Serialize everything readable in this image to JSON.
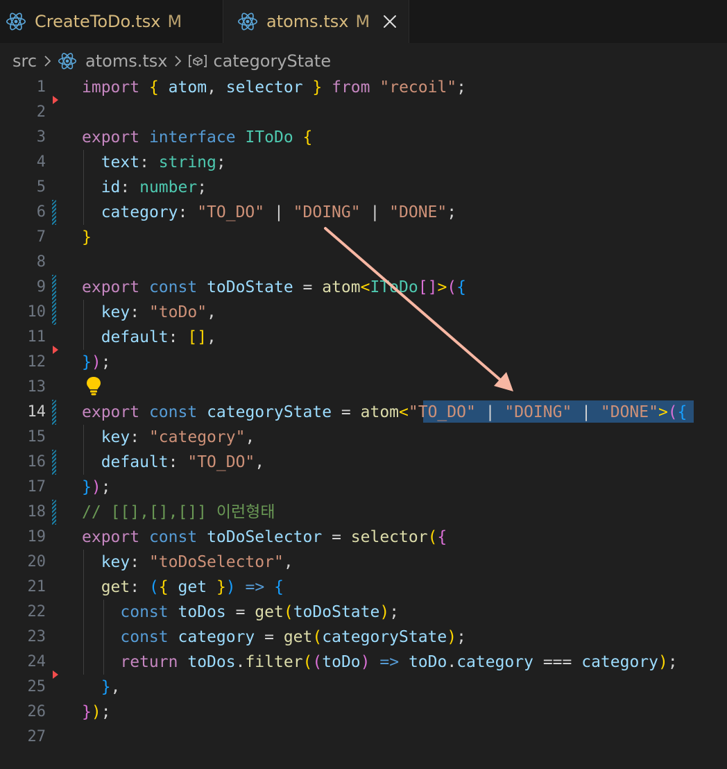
{
  "tabs": [
    {
      "filename": "CreateToDo.tsx",
      "status": "M"
    },
    {
      "filename": "atoms.tsx",
      "status": "M"
    }
  ],
  "breadcrumb": {
    "root": "src",
    "file": "atoms.tsx",
    "symbol": "categoryState"
  },
  "editor": {
    "current_line": 14,
    "lines": [
      {
        "n": "1",
        "tokens": [
          [
            "kw",
            "import"
          ],
          [
            "",
            "&nbsp;"
          ],
          [
            "p1",
            "{"
          ],
          [
            "",
            ""
          ],
          [
            "va",
            " atom"
          ],
          [
            "op",
            ","
          ],
          [
            "va",
            " selector "
          ],
          [
            "p1",
            "}"
          ],
          [
            "kw",
            " from "
          ],
          [
            "st",
            "\"recoil\""
          ],
          [
            "op",
            ";"
          ]
        ]
      }
    ]
  },
  "code": [
    {
      "n": "1"
    },
    {
      "n": "2"
    },
    {
      "n": "3"
    },
    {
      "n": "4"
    },
    {
      "n": "5"
    },
    {
      "n": "6"
    },
    {
      "n": "7"
    },
    {
      "n": "8"
    },
    {
      "n": "9"
    },
    {
      "n": "10"
    },
    {
      "n": "11"
    },
    {
      "n": "12"
    },
    {
      "n": "13"
    },
    {
      "n": "14"
    },
    {
      "n": "15"
    },
    {
      "n": "16"
    },
    {
      "n": "17"
    },
    {
      "n": "18"
    },
    {
      "n": "19"
    },
    {
      "n": "20"
    },
    {
      "n": "21"
    },
    {
      "n": "22"
    },
    {
      "n": "23"
    },
    {
      "n": "24"
    },
    {
      "n": "25"
    },
    {
      "n": "26"
    },
    {
      "n": "27"
    }
  ],
  "source": [
    [
      [
        "kw",
        "import"
      ],
      [
        "op",
        " "
      ],
      [
        "p1",
        "{"
      ],
      [
        "va",
        " atom"
      ],
      [
        "op",
        ", "
      ],
      [
        "va",
        "selector"
      ],
      [
        "op",
        " "
      ],
      [
        "p1",
        "}"
      ],
      [
        "kw",
        " from"
      ],
      [
        "op",
        " "
      ],
      [
        "st",
        "\"recoil\""
      ],
      [
        "op",
        ";"
      ]
    ],
    [],
    [
      [
        "kw",
        "export"
      ],
      [
        "op",
        " "
      ],
      [
        "bl",
        "interface"
      ],
      [
        "op",
        " "
      ],
      [
        "ty",
        "IToDo"
      ],
      [
        "op",
        " "
      ],
      [
        "p1",
        "{"
      ]
    ],
    [
      [
        "op",
        "  "
      ],
      [
        "va",
        "text"
      ],
      [
        "op",
        ": "
      ],
      [
        "ty",
        "string"
      ],
      [
        "op",
        ";"
      ]
    ],
    [
      [
        "op",
        "  "
      ],
      [
        "va",
        "id"
      ],
      [
        "op",
        ": "
      ],
      [
        "ty",
        "number"
      ],
      [
        "op",
        ";"
      ]
    ],
    [
      [
        "op",
        "  "
      ],
      [
        "va",
        "category"
      ],
      [
        "op",
        ": "
      ],
      [
        "st",
        "\"TO_DO\""
      ],
      [
        "op",
        " | "
      ],
      [
        "st",
        "\"DOING\""
      ],
      [
        "op",
        " | "
      ],
      [
        "st",
        "\"DONE\""
      ],
      [
        "op",
        ";"
      ]
    ],
    [
      [
        "p1",
        "}"
      ]
    ],
    [],
    [
      [
        "kw",
        "export"
      ],
      [
        "op",
        " "
      ],
      [
        "bl",
        "const"
      ],
      [
        "op",
        " "
      ],
      [
        "va",
        "toDoState"
      ],
      [
        "op",
        " = "
      ],
      [
        "fn",
        "atom"
      ],
      [
        "p1",
        "<"
      ],
      [
        "ty",
        "IToDo"
      ],
      [
        "p2",
        "[]"
      ],
      [
        "p1",
        ">"
      ],
      [
        "p2",
        "("
      ],
      [
        "p3",
        "{"
      ]
    ],
    [
      [
        "op",
        "  "
      ],
      [
        "va",
        "key"
      ],
      [
        "op",
        ": "
      ],
      [
        "st",
        "\"toDo\""
      ],
      [
        "op",
        ","
      ]
    ],
    [
      [
        "op",
        "  "
      ],
      [
        "va",
        "default"
      ],
      [
        "op",
        ": "
      ],
      [
        "p1",
        "[]"
      ],
      [
        "op",
        ","
      ]
    ],
    [
      [
        "p3",
        "}"
      ],
      [
        "p2",
        ")"
      ],
      [
        "op",
        ";"
      ]
    ],
    [],
    [
      [
        "kw",
        "export"
      ],
      [
        "op",
        " "
      ],
      [
        "bl",
        "const"
      ],
      [
        "op",
        " "
      ],
      [
        "va",
        "categoryState"
      ],
      [
        "op",
        " = "
      ],
      [
        "fn",
        "atom"
      ],
      [
        "p1",
        "<"
      ],
      [
        "st",
        "\"TO_DO\""
      ],
      [
        "op",
        " | "
      ],
      [
        "st",
        "\"DOING\""
      ],
      [
        "op",
        " | "
      ],
      [
        "st",
        "\"DONE\""
      ],
      [
        "p1",
        ">"
      ],
      [
        "p2",
        "("
      ],
      [
        "p3",
        "{"
      ]
    ],
    [
      [
        "op",
        "  "
      ],
      [
        "va",
        "key"
      ],
      [
        "op",
        ": "
      ],
      [
        "st",
        "\"category\""
      ],
      [
        "op",
        ","
      ]
    ],
    [
      [
        "op",
        "  "
      ],
      [
        "va",
        "default"
      ],
      [
        "op",
        ": "
      ],
      [
        "st",
        "\"TO_DO\""
      ],
      [
        "op",
        ","
      ]
    ],
    [
      [
        "p3",
        "}"
      ],
      [
        "p2",
        ")"
      ],
      [
        "op",
        ";"
      ]
    ],
    [
      [
        "cm",
        "// [[],[],[]] 이런형태"
      ]
    ],
    [
      [
        "kw",
        "export"
      ],
      [
        "op",
        " "
      ],
      [
        "bl",
        "const"
      ],
      [
        "op",
        " "
      ],
      [
        "va",
        "toDoSelector"
      ],
      [
        "op",
        " = "
      ],
      [
        "fn",
        "selector"
      ],
      [
        "p1",
        "("
      ],
      [
        "p2",
        "{"
      ]
    ],
    [
      [
        "op",
        "  "
      ],
      [
        "va",
        "key"
      ],
      [
        "op",
        ": "
      ],
      [
        "st",
        "\"toDoSelector\""
      ],
      [
        "op",
        ","
      ]
    ],
    [
      [
        "op",
        "  "
      ],
      [
        "fn",
        "get"
      ],
      [
        "op",
        ": "
      ],
      [
        "p3",
        "("
      ],
      [
        "p1",
        "{"
      ],
      [
        "op",
        " "
      ],
      [
        "va",
        "get"
      ],
      [
        "op",
        " "
      ],
      [
        "p1",
        "}"
      ],
      [
        "p3",
        ")"
      ],
      [
        "op",
        " "
      ],
      [
        "bl",
        "=>"
      ],
      [
        "op",
        " "
      ],
      [
        "p3",
        "{"
      ]
    ],
    [
      [
        "op",
        "    "
      ],
      [
        "bl",
        "const"
      ],
      [
        "op",
        " "
      ],
      [
        "va",
        "toDos"
      ],
      [
        "op",
        " = "
      ],
      [
        "fn",
        "get"
      ],
      [
        "p1",
        "("
      ],
      [
        "va",
        "toDoState"
      ],
      [
        "p1",
        ")"
      ],
      [
        "op",
        ";"
      ]
    ],
    [
      [
        "op",
        "    "
      ],
      [
        "bl",
        "const"
      ],
      [
        "op",
        " "
      ],
      [
        "va",
        "category"
      ],
      [
        "op",
        " = "
      ],
      [
        "fn",
        "get"
      ],
      [
        "p1",
        "("
      ],
      [
        "va",
        "categoryState"
      ],
      [
        "p1",
        ")"
      ],
      [
        "op",
        ";"
      ]
    ],
    [
      [
        "op",
        "    "
      ],
      [
        "kw",
        "return"
      ],
      [
        "op",
        " "
      ],
      [
        "va",
        "toDos"
      ],
      [
        "op",
        "."
      ],
      [
        "fn",
        "filter"
      ],
      [
        "p1",
        "("
      ],
      [
        "p2",
        "("
      ],
      [
        "va",
        "toDo"
      ],
      [
        "p2",
        ")"
      ],
      [
        "op",
        " "
      ],
      [
        "bl",
        "=>"
      ],
      [
        "op",
        " "
      ],
      [
        "va",
        "toDo"
      ],
      [
        "op",
        "."
      ],
      [
        "va",
        "category"
      ],
      [
        "op",
        " === "
      ],
      [
        "va",
        "category"
      ],
      [
        "p1",
        ")"
      ],
      [
        "op",
        ";"
      ]
    ],
    [
      [
        "op",
        "  "
      ],
      [
        "p3",
        "}"
      ],
      [
        "op",
        ","
      ]
    ],
    [
      [
        "p2",
        "}"
      ],
      [
        "p1",
        ")"
      ],
      [
        "op",
        ";"
      ]
    ],
    []
  ]
}
